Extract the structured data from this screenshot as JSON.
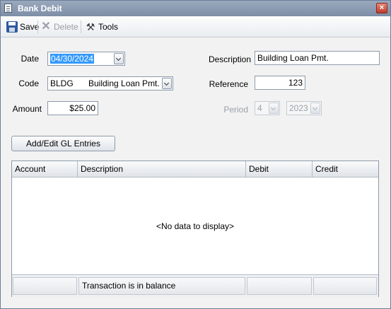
{
  "window": {
    "title": "Bank Debit",
    "close_symbol": "×"
  },
  "toolbar": {
    "save_label": "Save",
    "delete_label": "Delete",
    "tools_label": "Tools"
  },
  "form": {
    "date_label": "Date",
    "date_value": "04/30/2024",
    "code_label": "Code",
    "code_value": "BLDG",
    "code_description": "Building Loan Pmt.",
    "amount_label": "Amount",
    "amount_value": "$25.00",
    "description_label": "Description",
    "description_value": "Building Loan Pmt.",
    "reference_label": "Reference",
    "reference_value": "123",
    "period_label": "Period",
    "period_month": "4",
    "period_year": "2023"
  },
  "gl_button_label": "Add/Edit GL Entries",
  "grid": {
    "columns": [
      "Account",
      "Description",
      "Debit",
      "Credit"
    ],
    "empty_message": "<No data to display>",
    "footer_status": "Transaction is in balance"
  },
  "icons": {
    "save": "save-icon",
    "delete": "delete-icon",
    "tools": "tools-icon",
    "app": "document-icon",
    "close": "close-icon",
    "dropdown": "chevron-down-icon"
  }
}
